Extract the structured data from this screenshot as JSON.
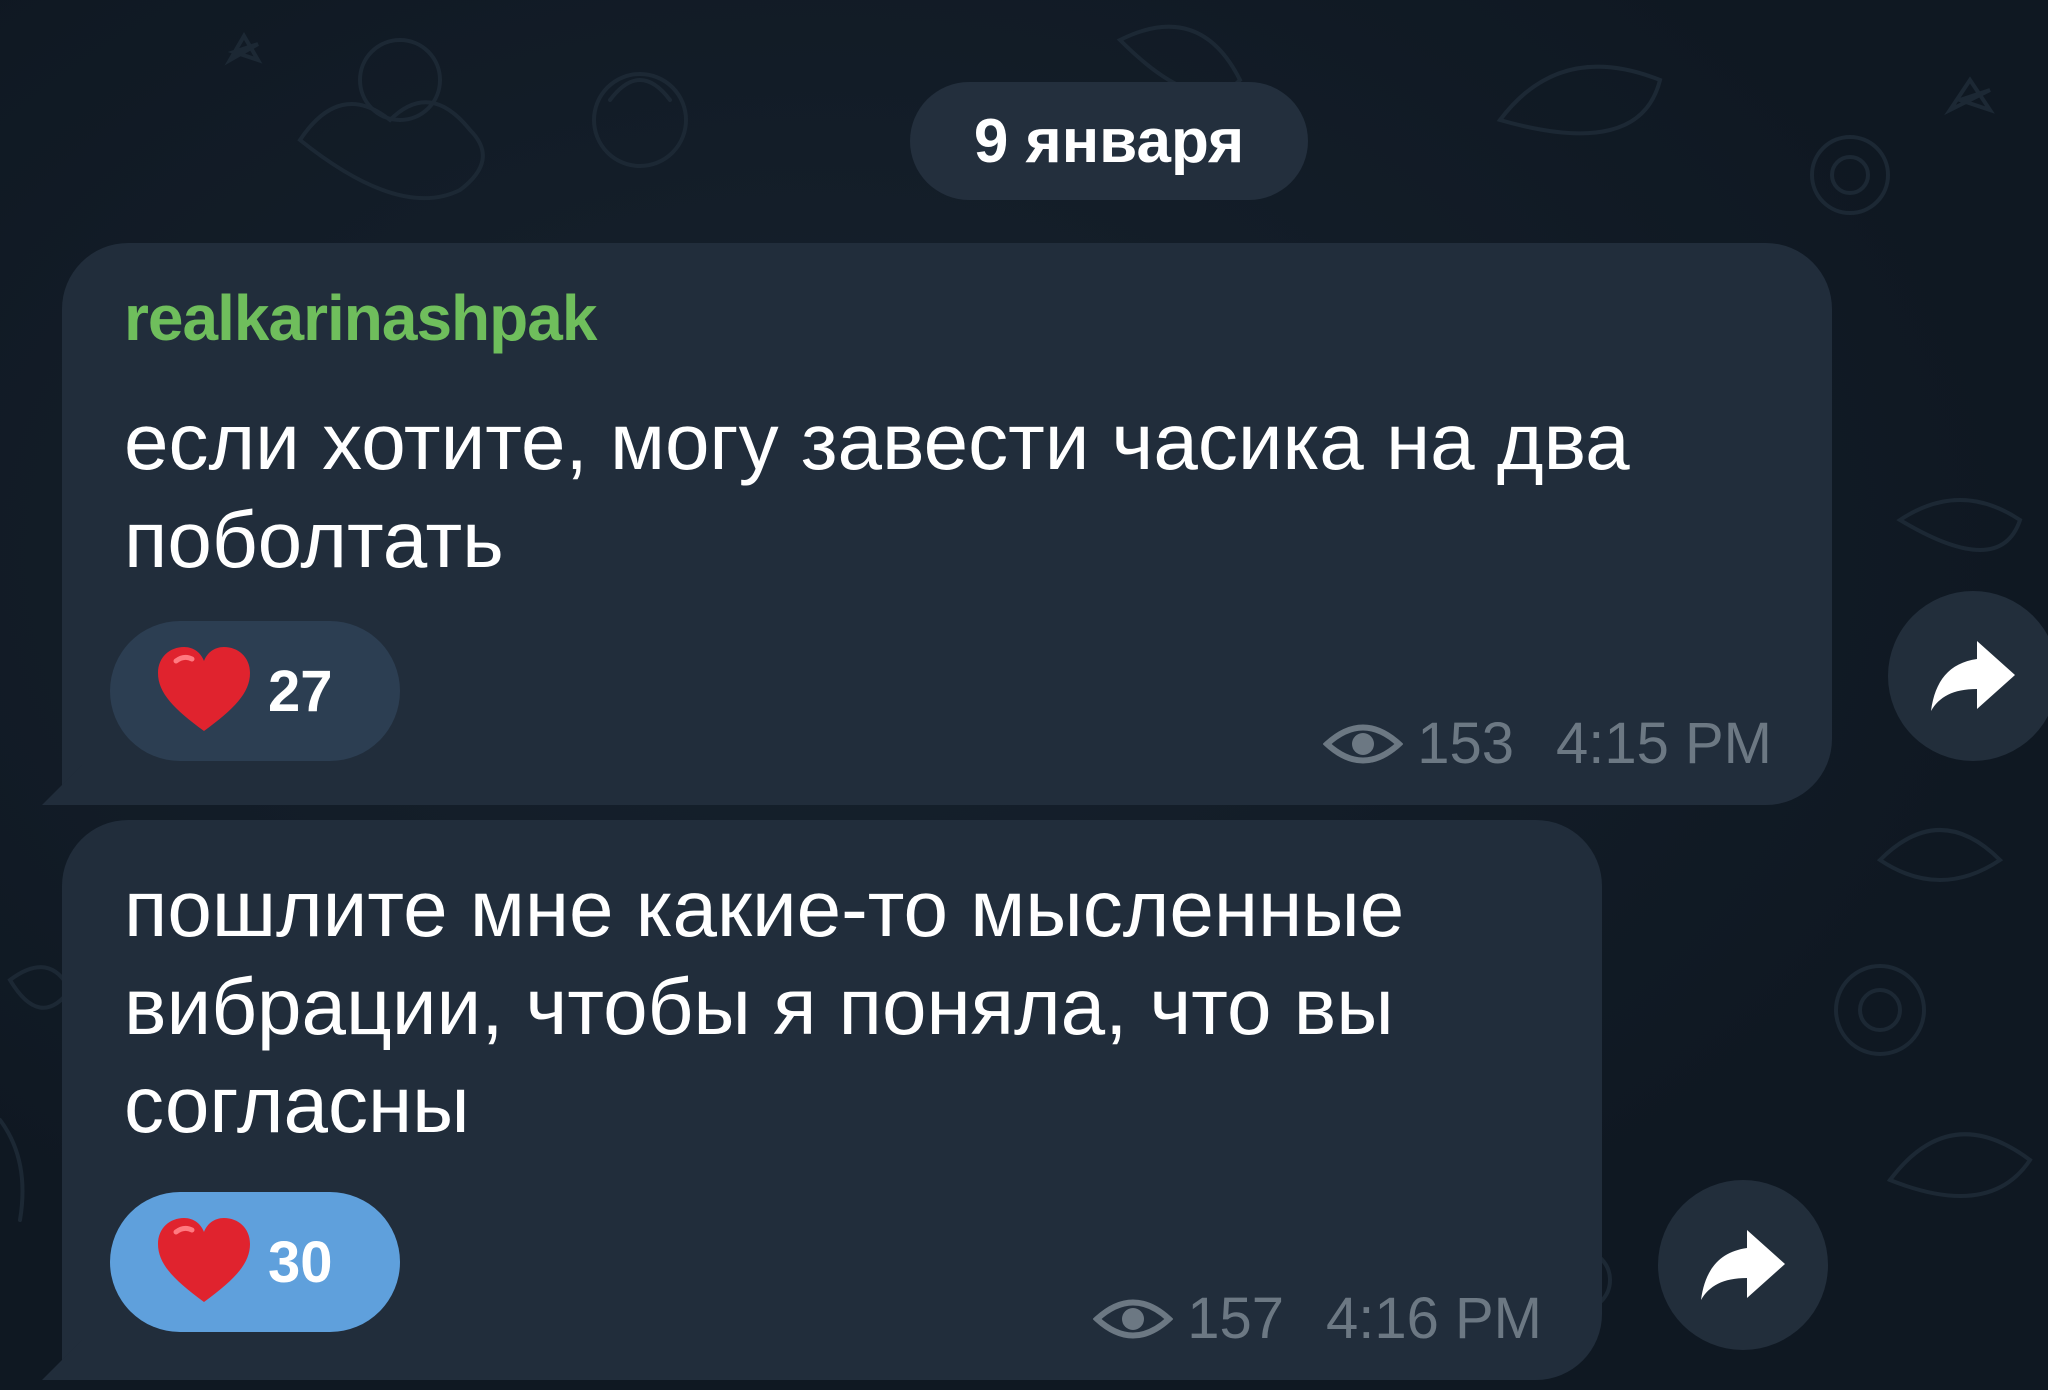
{
  "date_separator": "9 января",
  "messages": [
    {
      "sender": "realkarinashpak",
      "text": "если хотите, могу завести часика на два поболтать",
      "reaction": {
        "emoji_icon": "red-heart-icon",
        "count": "27",
        "highlighted": false
      },
      "views": "153",
      "time": "4:15 PM"
    },
    {
      "text": "пошлите мне какие-то мысленные вибрации, чтобы я поняла, что вы согласны",
      "reaction": {
        "emoji_icon": "red-heart-icon",
        "count": "30",
        "highlighted": true
      },
      "views": "157",
      "time": "4:16 PM"
    }
  ],
  "colors": {
    "background": "#0f1822",
    "bubble": "#212d3b",
    "sender_name": "#6fbe5c",
    "meta_text": "#6c7883",
    "reaction_default": "#2c3e52",
    "reaction_highlighted": "#5fa0dc",
    "heart": "#e0232e"
  }
}
